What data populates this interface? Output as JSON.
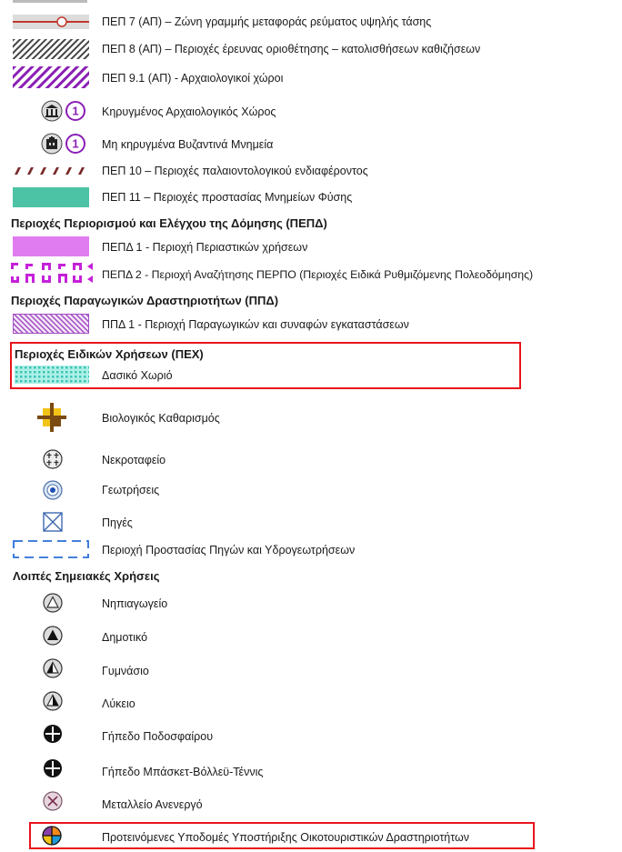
{
  "legend": {
    "items": [
      {
        "id": "pep7",
        "label": "ΠΕΠ 7 (ΑΠ) – Ζώνη γραμμής μεταφοράς ρεύματος υψηλής τάσης",
        "icon": "power-line-icon"
      },
      {
        "id": "pep8",
        "label": "ΠΕΠ 8 (ΑΠ) – Περιοχές έρευνας οριοθέτησης – κατολισθήσεων καθιζήσεων",
        "icon": "hatch-gray-icon"
      },
      {
        "id": "pep91",
        "label": "ΠΕΠ 9.1 (ΑΠ) - Αρχαιολογικοί χώροι",
        "icon": "hatch-purple-icon"
      },
      {
        "id": "arch-declared",
        "label": "Κηρυγμένος Αρχαιολογικός Χώρος",
        "icon": "temple-icon",
        "badge": "1"
      },
      {
        "id": "byzantine",
        "label": "Μη κηρυγμένα Βυζαντινά Μνημεία",
        "icon": "church-icon",
        "badge": "1"
      },
      {
        "id": "pep10",
        "label": "ΠΕΠ 10  – Περιοχές παλαιοντολογικού ενδιαφέροντος",
        "icon": "paleo-dashes-icon"
      },
      {
        "id": "pep11",
        "label": "ΠΕΠ 11 – Περιοχές προστασίας Μνημείων Φύσης",
        "icon": "teal-fill-icon"
      }
    ],
    "sections": {
      "pepd": "Περιοχές Περιορισμού και Ελέγχου της Δόμησης (ΠΕΠΔ)",
      "ppd": "Περιοχές Παραγωγικών Δραστηριοτήτων (ΠΠΔ)",
      "pex": "Περιοχές Ειδικών Χρήσεων (ΠΕΧ)",
      "points": "Λοιπές Σημειακές Χρήσεις"
    },
    "pepd_items": [
      {
        "label": "ΠΕΠΔ  1 - Περιοχή Περιαστικών χρήσεων",
        "icon": "magenta-fill-icon"
      },
      {
        "label": "ΠΕΠΔ  2 -  Περιοχή Αναζήτησης ΠΕΡΠΟ (Περιοχές Ειδικά Ρυθμιζόμενης Πολεοδόμησης)",
        "icon": "magenta-battlement-icon"
      }
    ],
    "ppd_items": [
      {
        "label": "ΠΠΔ 1 - Περιοχή Παραγωγικών και συναφών εγκαταστάσεων",
        "icon": "pink-hatch-icon"
      }
    ],
    "pex_items": [
      {
        "label": "Δασικό Χωριό",
        "icon": "forest-village-icon"
      },
      {
        "label": "Βιολογικός Καθαρισμός",
        "icon": "bio-treatment-icon"
      },
      {
        "label": "Νεκροταφείο",
        "icon": "cemetery-icon"
      },
      {
        "label": "Γεωτρήσεις",
        "icon": "borehole-icon"
      },
      {
        "label": "Πηγές",
        "icon": "spring-icon"
      },
      {
        "label": "Περιοχή Προστασίας Πηγών και Υδρογεωτρήσεων",
        "icon": "dashed-protection-icon"
      }
    ],
    "point_items": [
      {
        "label": "Νηπιαγωγείο",
        "icon": "kindergarten-icon"
      },
      {
        "label": "Δημοτικό",
        "icon": "primary-school-icon"
      },
      {
        "label": "Γυμνάσιο",
        "icon": "gymnasium-icon"
      },
      {
        "label": "Λύκειο",
        "icon": "lyceum-icon"
      },
      {
        "label": "Γήπεδο Ποδοσφαίρου",
        "icon": "football-field-icon"
      },
      {
        "label": "Γήπεδο Μπάσκετ-Βόλλεϋ-Τέννις",
        "icon": "basketball-court-icon"
      },
      {
        "label": "Μεταλλείο Ανενεργό",
        "icon": "inactive-mine-icon"
      },
      {
        "label": "Προτεινόμενες Υποδομές Υποστήριξης Οικοτουριστικών Δραστηριοτήτων",
        "icon": "ecotourism-icon"
      }
    ]
  },
  "colors": {
    "highlight": "#e8141c",
    "purple": "#8b1fb5",
    "magenta": "#e07cf0",
    "teal": "#4cc3a5",
    "dashed_blue": "#2a6fd6",
    "forest_teal": "#8fe6dc"
  }
}
